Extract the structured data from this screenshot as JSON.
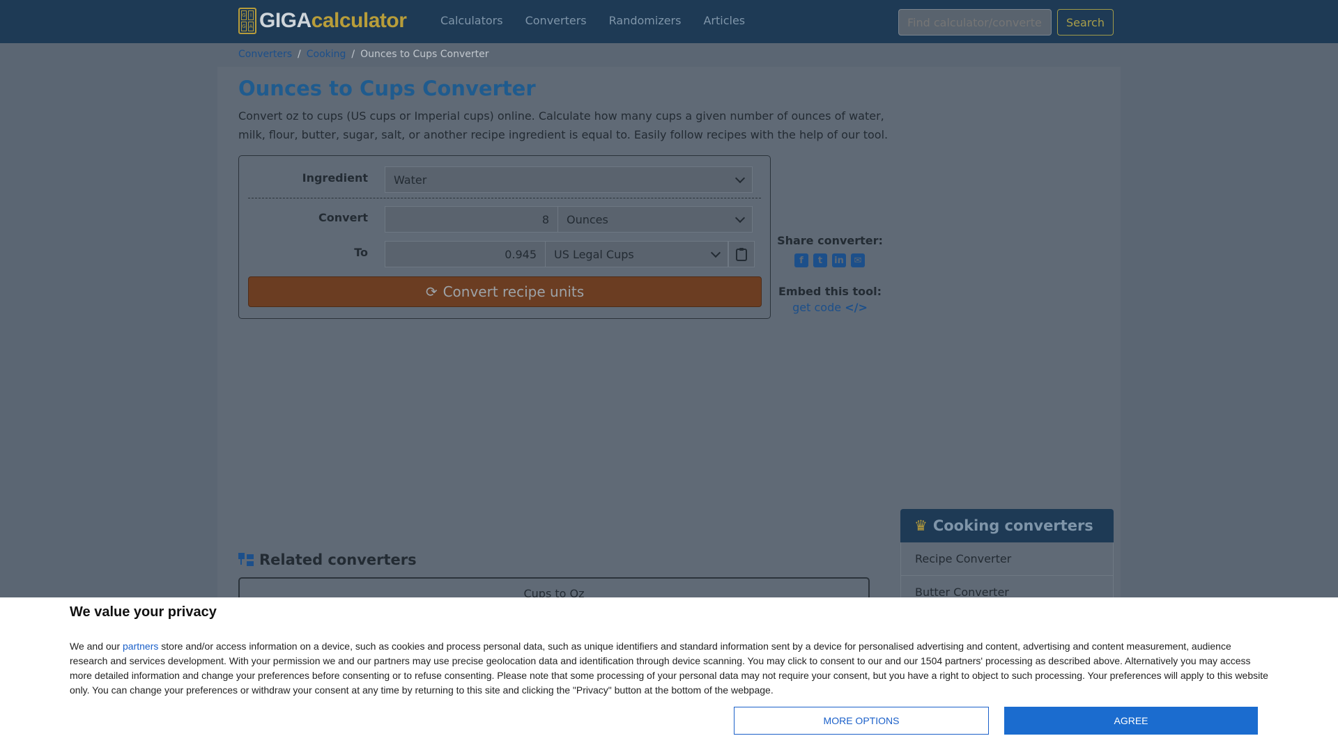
{
  "header": {
    "logo_text_a": "GIGA",
    "logo_text_b": "calculator",
    "nav": [
      "Calculators",
      "Converters",
      "Randomizers",
      "Articles"
    ],
    "search_placeholder": "Find calculator/converter",
    "search_button": "Search"
  },
  "breadcrumb": [
    "Converters",
    "Cooking",
    "Ounces to Cups Converter"
  ],
  "page": {
    "title": "Ounces to Cups Converter",
    "lead": "Convert oz to cups (US cups or Imperial cups) online. Calculate how many cups a given number of ounces of water, milk, flour, butter, sugar, salt, or another recipe ingredient is equal to. Easily follow recipes with the help of our tool."
  },
  "converter": {
    "ingredient_label": "Ingredient",
    "ingredient_value": "Water",
    "convert_label": "Convert",
    "convert_value": "8",
    "convert_unit": "Ounces",
    "to_label": "To",
    "to_value": "0.945",
    "to_unit": "US Legal Cups",
    "button": "Convert recipe units"
  },
  "share": {
    "title": "Share converter:",
    "icons": [
      "facebook-icon",
      "twitter-icon",
      "linkedin-icon",
      "email-icon"
    ],
    "embed_title": "Embed this tool:",
    "embed_link": "get code"
  },
  "related": {
    "title": "Related converters",
    "items": [
      "Cups to Oz"
    ]
  },
  "sidebar": {
    "title": "Cooking converters",
    "items": [
      "Recipe Converter",
      "Butter Converter"
    ]
  },
  "consent": {
    "title": "We value your privacy",
    "text_pre": "We and our ",
    "partners_link": "partners",
    "text_post": " store and/or access information on a device, such as cookies and process personal data, such as unique identifiers and standard information sent by a device for personalised advertising and content, advertising and content measurement, audience research and services development. With your permission we and our partners may use precise geolocation data and identification through device scanning. You may click to consent to our and our 1504 partners' processing as described above. Alternatively you may access more detailed information and change your preferences before consenting or to refuse consenting. Please note that some processing of your personal data may not require your consent, but you have a right to object to such processing. Your preferences will apply to this website only. You can change your preferences or withdraw your consent at any time by returning to this site and clicking the \"Privacy\" button at the bottom of the webpage.",
    "more_options": "MORE OPTIONS",
    "agree": "AGREE"
  },
  "colors": {
    "header_bg": "#1e3a55",
    "accent_gold": "#b89d3a",
    "link_blue": "#1c4f8a",
    "convert_button": "#6b3d22",
    "agree_button": "#1b6ccf"
  }
}
